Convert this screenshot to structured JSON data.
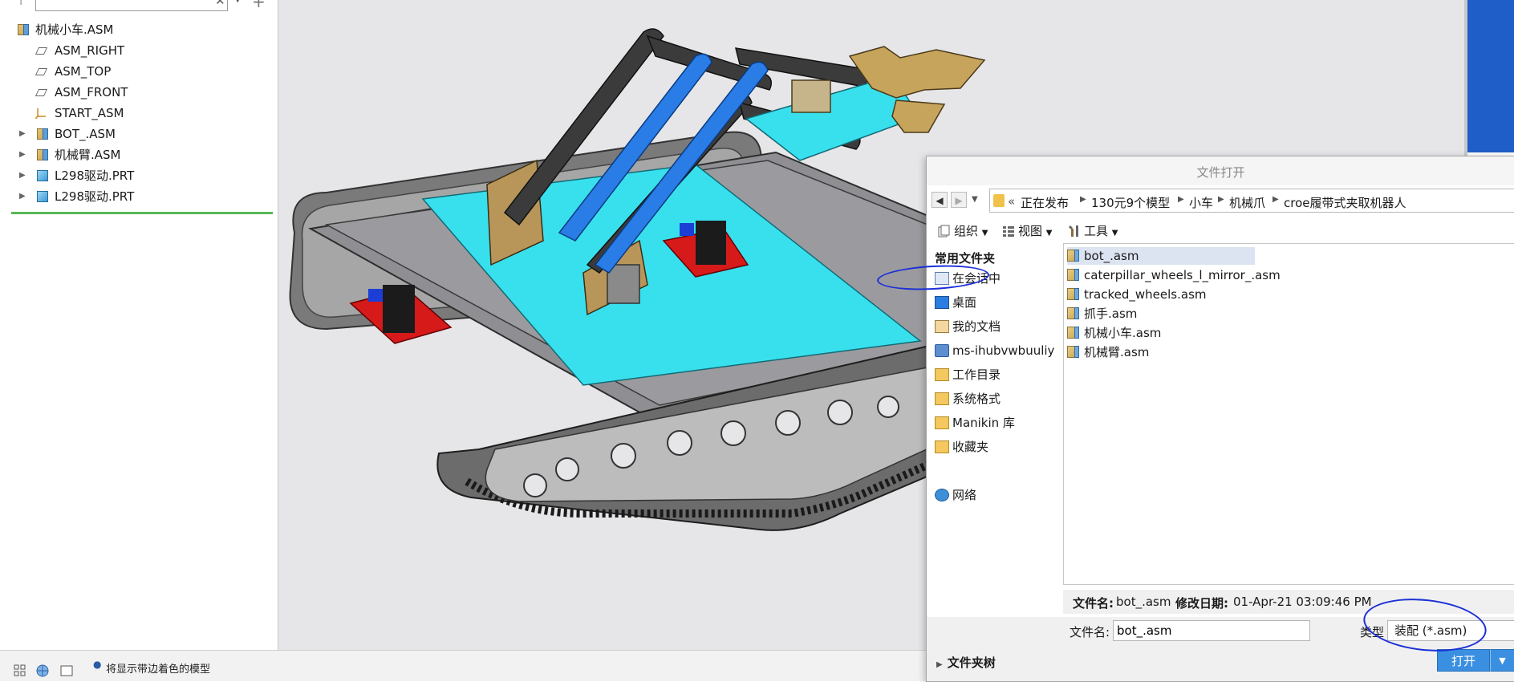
{
  "model_tree": {
    "search_value": "",
    "items": [
      {
        "label": "机械小车.ASM",
        "type": "asm",
        "expander": false,
        "indent": 0
      },
      {
        "label": "ASM_RIGHT",
        "type": "plane",
        "expander": false,
        "indent": 1
      },
      {
        "label": "ASM_TOP",
        "type": "plane",
        "expander": false,
        "indent": 1
      },
      {
        "label": "ASM_FRONT",
        "type": "plane",
        "expander": false,
        "indent": 1
      },
      {
        "label": "START_ASM",
        "type": "csys",
        "expander": false,
        "indent": 1
      },
      {
        "label": "BOT_.ASM",
        "type": "asm",
        "expander": true,
        "indent": 1
      },
      {
        "label": "机械臂.ASM",
        "type": "asm",
        "expander": true,
        "indent": 1
      },
      {
        "label": "L298驱动.PRT",
        "type": "prt",
        "expander": true,
        "indent": 1
      },
      {
        "label": "L298驱动.PRT",
        "type": "prt",
        "expander": true,
        "indent": 1
      }
    ]
  },
  "status_bar": {
    "message": "将显示带边着色的模型"
  },
  "dialog": {
    "title": "文件打开",
    "breadcrumb": [
      "正在发布",
      "130元9个模型",
      "小车",
      "机械爪",
      "croe履带式夹取机器人"
    ],
    "toolbar": {
      "organize": "组织",
      "view": "视图",
      "tools": "工具"
    },
    "left_nav": {
      "heading": "常用文件夹",
      "items": [
        "在会话中",
        "桌面",
        "我的文档",
        "ms-ihubvwbuuliy",
        "工作目录",
        "系统格式",
        "Manikin 库",
        "收藏夹"
      ],
      "network": "网络"
    },
    "files": [
      "bot_.asm",
      "caterpillar_wheels_l_mirror_.asm",
      "tracked_wheels.asm",
      "抓手.asm",
      "机械小车.asm",
      "机械臂.asm"
    ],
    "selected_file_index": 0,
    "info": {
      "name_label": "文件名:",
      "name_value": "bot_.asm",
      "modified_label": "修改日期:",
      "modified_value": "01-Apr-21 03:09:46 PM"
    },
    "filename_label": "文件名:",
    "filename_value": "bot_.asm",
    "type_label": "类型",
    "type_value": "装配 (*.asm)",
    "folder_tree_label": "文件夹树",
    "open_button": "打开"
  },
  "colors": {
    "viewport_bg": "#e6e6e9",
    "accent_blue": "#3a8fe0",
    "annotation": "#1c2fd8",
    "tree_divider": "#56b856"
  }
}
